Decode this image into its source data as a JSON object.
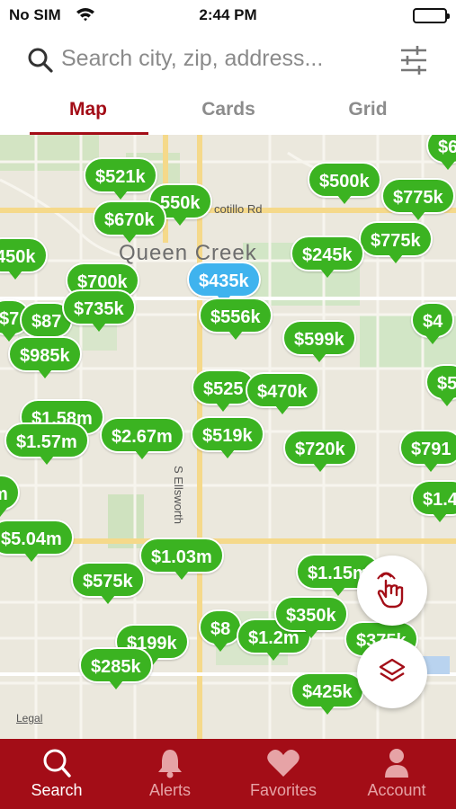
{
  "status_bar": {
    "carrier": "No SIM",
    "time": "2:44 PM"
  },
  "search": {
    "placeholder": "Search city, zip, address..."
  },
  "view_tabs": {
    "items": [
      {
        "label": "Map"
      },
      {
        "label": "Cards"
      },
      {
        "label": "Grid"
      }
    ],
    "active": "Map"
  },
  "map": {
    "city_label": "Queen Creek",
    "road_labels": {
      "ocotillo": "cotillo Rd",
      "ellsworth": "S Ellsworth"
    },
    "legal": "Legal",
    "pins": [
      {
        "label": "$6"
      },
      {
        "label": "$500k"
      },
      {
        "label": "$775k"
      },
      {
        "label": "$521k"
      },
      {
        "label": "550k"
      },
      {
        "label": "$670k"
      },
      {
        "label": "$775k"
      },
      {
        "label": "$245k"
      },
      {
        "label": "450k"
      },
      {
        "label": "$700k"
      },
      {
        "label": "$435k"
      },
      {
        "label": "$7"
      },
      {
        "label": "$87"
      },
      {
        "label": "$735k"
      },
      {
        "label": "$556k"
      },
      {
        "label": "$599k"
      },
      {
        "label": "$4"
      },
      {
        "label": "$985k"
      },
      {
        "label": "$525"
      },
      {
        "label": "$470k"
      },
      {
        "label": "$5"
      },
      {
        "label": "$1.58m"
      },
      {
        "label": "$1.57m"
      },
      {
        "label": "$2.67m"
      },
      {
        "label": "$519k"
      },
      {
        "label": "$720k"
      },
      {
        "label": "$791"
      },
      {
        "label": "m"
      },
      {
        "label": "$1.4"
      },
      {
        "label": "$5.04m"
      },
      {
        "label": "$1.03m"
      },
      {
        "label": "$575k"
      },
      {
        "label": "$1.15m"
      },
      {
        "label": "$199k"
      },
      {
        "label": "$8"
      },
      {
        "label": "$1.2m"
      },
      {
        "label": "$350k"
      },
      {
        "label": "$375k"
      },
      {
        "label": "$285k"
      },
      {
        "label": "$425k"
      }
    ]
  },
  "tab_bar": {
    "items": [
      {
        "label": "Search"
      },
      {
        "label": "Alerts"
      },
      {
        "label": "Favorites"
      },
      {
        "label": "Account"
      }
    ],
    "active": "Search"
  },
  "colors": {
    "brand_red": "#a30d17",
    "pin_green": "#3bb321",
    "pin_selected": "#3fb3ee"
  }
}
